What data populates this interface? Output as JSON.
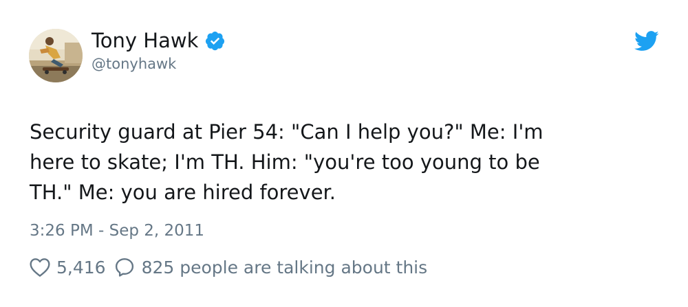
{
  "author": {
    "display_name": "Tony Hawk",
    "handle": "@tonyhawk",
    "verified": true,
    "avatar_icon": "skater-avatar"
  },
  "platform": {
    "icon": "twitter-bird-icon",
    "accent_color": "#1da1f2"
  },
  "tweet": {
    "text_lines": [
      "Security guard at Pier 54: \"Can I help you?\" Me: I'm",
      "here to skate; I'm TH. Him: \"you're too young to be",
      "TH.\" Me: you are hired forever."
    ],
    "timestamp": "3:26 PM - Sep 2, 2011"
  },
  "engagement": {
    "likes": "5,416",
    "talking": "825 people are talking about this"
  },
  "colors": {
    "text": "#14171a",
    "secondary": "#657786",
    "verified_badge": "#1da1f2"
  }
}
